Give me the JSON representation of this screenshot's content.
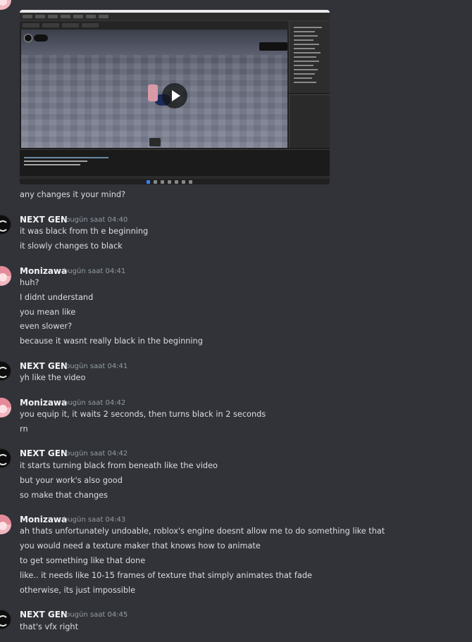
{
  "video": {
    "play_label": "Play"
  },
  "messages": [
    {
      "id": "m0",
      "author": "",
      "timestamp": "",
      "lines": [
        "any changes it your mind?"
      ]
    },
    {
      "id": "m1",
      "author": "NEXT GEN",
      "timestamp": "bugün saat 04:40",
      "lines": [
        "it was black from th e beginning",
        "it slowly changes to black"
      ]
    },
    {
      "id": "m2",
      "author": "Monizawa",
      "timestamp": "bugün saat 04:41",
      "lines": [
        "huh?",
        "I didnt understand",
        "you mean like",
        "even slower?",
        "because it wasnt really black in the beginning"
      ]
    },
    {
      "id": "m3",
      "author": "NEXT GEN",
      "timestamp": "bugün saat 04:41",
      "lines": [
        "yh like the video"
      ]
    },
    {
      "id": "m4",
      "author": "Monizawa",
      "timestamp": "bugün saat 04:42",
      "lines": [
        "you equip it, it waits 2 seconds, then turns black in 2 seconds",
        "rn"
      ]
    },
    {
      "id": "m5",
      "author": "NEXT GEN",
      "timestamp": "bugün saat 04:42",
      "lines": [
        "it starts turning black from beneath like the video",
        "but your work's also good",
        "so make that changes"
      ]
    },
    {
      "id": "m6",
      "author": "Monizawa",
      "timestamp": "bugün saat 04:43",
      "lines": [
        "ah thats unfortunately undoable, roblox's engine doesnt allow me to do something like that",
        "you would need a texture maker  that knows how to animate",
        "to get something like that done",
        "like.. it needs like 10-15 frames of texture that simply animates that fade",
        "otherwise, its just impossible"
      ]
    },
    {
      "id": "m7",
      "author": "NEXT GEN",
      "timestamp": "bugün saat 04:45",
      "lines": [
        "that's vfx right"
      ]
    }
  ]
}
